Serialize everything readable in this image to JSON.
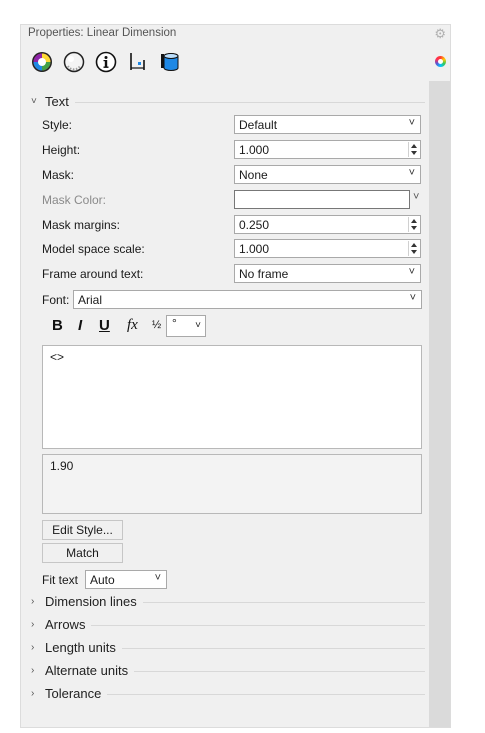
{
  "panel": {
    "title": "Properties: Linear Dimension",
    "settings_icon": "gear-icon"
  },
  "tabs": [
    {
      "name": "color-wheel-icon"
    },
    {
      "name": "material-sphere-icon"
    },
    {
      "name": "info-icon"
    },
    {
      "name": "dimension-icon"
    },
    {
      "name": "layers-icon"
    }
  ],
  "text_section": {
    "header": "Text",
    "style_label": "Style:",
    "style_value": "Default",
    "height_label": "Height:",
    "height_value": "1.000",
    "mask_label": "Mask:",
    "mask_value": "None",
    "mask_color_label": "Mask Color:",
    "mask_margins_label": "Mask margins:",
    "mask_margins_value": "0.250",
    "model_space_scale_label": "Model space scale:",
    "model_space_scale_value": "1.000",
    "frame_label": "Frame around text:",
    "frame_value": "No frame",
    "font_label": "Font:",
    "font_value": "Arial",
    "format": {
      "bold": "B",
      "italic": "I",
      "underline": "U",
      "function": "fx",
      "fraction": "½",
      "degree_value": "°"
    },
    "text_value": "<>",
    "preview_value": "1.90",
    "edit_style_label": "Edit Style...",
    "match_label": "Match",
    "fit_text_label": "Fit text",
    "fit_text_value": "Auto"
  },
  "collapsed_sections": [
    "Dimension lines",
    "Arrows",
    "Length units",
    "Alternate units",
    "Tolerance"
  ]
}
